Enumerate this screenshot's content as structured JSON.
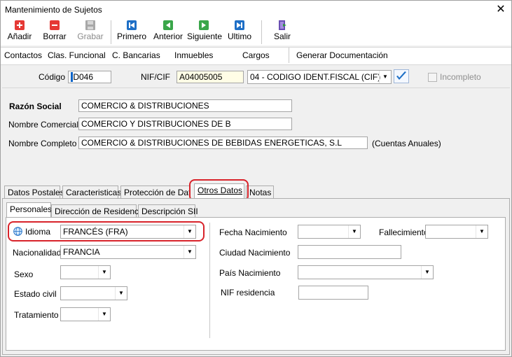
{
  "window": {
    "title": "Mantenimiento de Sujetos",
    "close_glyph": "✕"
  },
  "toolbar": {
    "add": "Añadir",
    "delete": "Borrar",
    "save": "Grabar",
    "first": "Primero",
    "prev": "Anterior",
    "next": "Siguiente",
    "last": "Ultimo",
    "exit": "Salir"
  },
  "menu": [
    "Contactos",
    "Clas. Funcional",
    "C. Bancarias",
    "Inmuebles",
    "Cargos",
    "Generar Documentación"
  ],
  "header": {
    "codigo_label": "Código",
    "codigo_value": "D046",
    "nif_label": "NIF/CIF",
    "nif_value": "A04005005",
    "nif_type_value": "04 - CODIGO IDENT.FISCAL (CIF)",
    "incompleto_label": "Incompleto"
  },
  "names": {
    "razon_label": "Razón Social",
    "razon_value": "COMERCIO & DISTRIBUCIONES",
    "comercial_label": "Nombre Comercial",
    "comercial_value": "COMERCIO Y DISTRIBUCIONES DE B",
    "completo_label": "Nombre Completo",
    "completo_value": "COMERCIO & DISTRIBUCIONES DE BEBIDAS ENERGETICAS, S.L",
    "cuentas_note": "(Cuentas Anuales)"
  },
  "tabs": [
    "Datos Postales",
    "Caracteristicas",
    "Protección de Datos",
    "Otros Datos",
    "Notas"
  ],
  "subtabs": [
    "Personales",
    "Dirección de Residencia",
    "Descripción SII"
  ],
  "personal": {
    "idioma_label": "Idioma",
    "idioma_value": "FRANCÉS  (FRA)",
    "nacionalidad_label": "Nacionalidad",
    "nacionalidad_value": "FRANCIA",
    "sexo_label": "Sexo",
    "estado_label": "Estado civil",
    "tratamiento_label": "Tratamiento",
    "fecha_label": "Fecha Nacimiento",
    "fallecimiento_label": "Fallecimiento",
    "ciudad_label": "Ciudad Nacimiento",
    "pais_label": "País Nacimiento",
    "nif_res_label": "NIF residencia"
  },
  "colors": {
    "highlight": "#d8232a",
    "add_icon": "#e53935",
    "delete_icon": "#e53935",
    "nav_icon": "#1e6fc6",
    "next_icon": "#3aa64a"
  }
}
